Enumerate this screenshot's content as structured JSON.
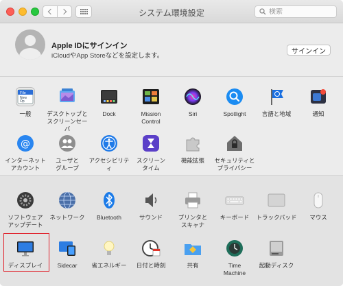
{
  "window": {
    "title": "システム環境設定",
    "search_placeholder": "検索"
  },
  "account": {
    "title": "Apple IDにサインイン",
    "subtitle": "iCloudやApp Storeなどを設定します。",
    "signin_label": "サインイン"
  },
  "row1": [
    {
      "label": "一般",
      "icon": "general-icon"
    },
    {
      "label": "デスクトップと\nスクリーンセーバ",
      "icon": "desktop-screensaver-icon"
    },
    {
      "label": "Dock",
      "icon": "dock-icon"
    },
    {
      "label": "Mission\nControl",
      "icon": "mission-control-icon"
    },
    {
      "label": "Siri",
      "icon": "siri-icon"
    },
    {
      "label": "Spotlight",
      "icon": "spotlight-icon"
    },
    {
      "label": "言語と地域",
      "icon": "language-region-icon"
    },
    {
      "label": "通知",
      "icon": "notifications-icon"
    }
  ],
  "row2": [
    {
      "label": "インターネット\nアカウント",
      "icon": "internet-accounts-icon"
    },
    {
      "label": "ユーザと\nグループ",
      "icon": "users-groups-icon"
    },
    {
      "label": "アクセシビリティ",
      "icon": "accessibility-icon"
    },
    {
      "label": "スクリーン\nタイム",
      "icon": "screen-time-icon"
    },
    {
      "label": "機能拡張",
      "icon": "extensions-icon"
    },
    {
      "label": "セキュリティと\nプライバシー",
      "icon": "security-privacy-icon"
    }
  ],
  "row3": [
    {
      "label": "ソフトウェア\nアップデート",
      "icon": "software-update-icon"
    },
    {
      "label": "ネットワーク",
      "icon": "network-icon"
    },
    {
      "label": "Bluetooth",
      "icon": "bluetooth-icon"
    },
    {
      "label": "サウンド",
      "icon": "sound-icon"
    },
    {
      "label": "プリンタと\nスキャナ",
      "icon": "printers-scanners-icon"
    },
    {
      "label": "キーボード",
      "icon": "keyboard-icon"
    },
    {
      "label": "トラックパッド",
      "icon": "trackpad-icon"
    },
    {
      "label": "マウス",
      "icon": "mouse-icon"
    }
  ],
  "row4": [
    {
      "label": "ディスプレイ",
      "icon": "displays-icon"
    },
    {
      "label": "Sidecar",
      "icon": "sidecar-icon"
    },
    {
      "label": "省エネルギー",
      "icon": "energy-saver-icon"
    },
    {
      "label": "日付と時刻",
      "icon": "date-time-icon"
    },
    {
      "label": "共有",
      "icon": "sharing-icon"
    },
    {
      "label": "Time\nMachine",
      "icon": "time-machine-icon"
    },
    {
      "label": "起動ディスク",
      "icon": "startup-disk-icon"
    }
  ],
  "colors": {
    "highlight": "#e0202a",
    "accent": "#1a7cf5"
  }
}
